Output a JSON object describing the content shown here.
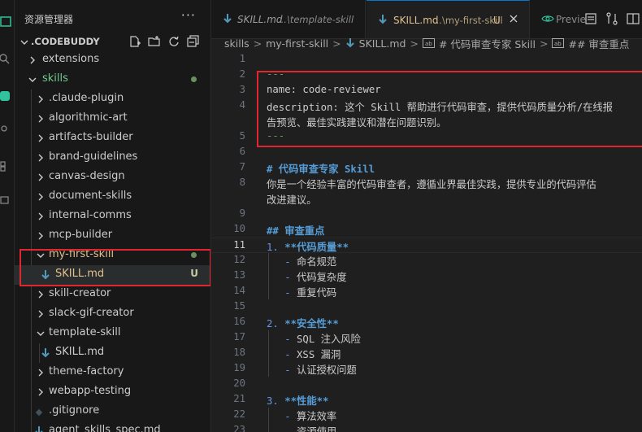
{
  "sidebar": {
    "title": "资源管理器",
    "more": "···",
    "section": "CODEBUDDY",
    "tree": [
      {
        "label": "extensions",
        "type": "folder",
        "open": false
      },
      {
        "label": "skills",
        "type": "folder",
        "open": true,
        "modified": true
      },
      {
        "label": ".claude-plugin",
        "type": "folder",
        "open": false
      },
      {
        "label": "algorithmic-art",
        "type": "folder",
        "open": false
      },
      {
        "label": "artifacts-builder",
        "type": "folder",
        "open": false
      },
      {
        "label": "brand-guidelines",
        "type": "folder",
        "open": false
      },
      {
        "label": "canvas-design",
        "type": "folder",
        "open": false
      },
      {
        "label": "document-skills",
        "type": "folder",
        "open": false
      },
      {
        "label": "internal-comms",
        "type": "folder",
        "open": false
      },
      {
        "label": "mcp-builder",
        "type": "folder",
        "open": false
      },
      {
        "label": "my-first-skill",
        "type": "folder",
        "open": true,
        "modified": true
      },
      {
        "label": "SKILL.md",
        "type": "file",
        "status": "U"
      },
      {
        "label": "skill-creator",
        "type": "folder",
        "open": false
      },
      {
        "label": "slack-gif-creator",
        "type": "folder",
        "open": false
      },
      {
        "label": "template-skill",
        "type": "folder",
        "open": true
      },
      {
        "label": "SKILL.md",
        "type": "file"
      },
      {
        "label": "theme-factory",
        "type": "folder",
        "open": false
      },
      {
        "label": "webapp-testing",
        "type": "folder",
        "open": false
      },
      {
        "label": ".gitignore",
        "type": "file"
      },
      {
        "label": "agent_skills_spec.md",
        "type": "file"
      }
    ]
  },
  "tabs": [
    {
      "name": "SKILL.md",
      "path": "...\\template-skill",
      "preview": true
    },
    {
      "name": "SKILL.md",
      "path": "...\\my-first-skill",
      "status": "U",
      "active": true
    },
    {
      "name": "Previe"
    }
  ],
  "breadcrumb": [
    "skills",
    "my-first-skill",
    "SKILL.md",
    "# 代码审查专家 Skill",
    "## 审查重点"
  ],
  "editor": {
    "current_line": 11,
    "lines": [
      {
        "n": "1",
        "parts": []
      },
      {
        "n": "2",
        "parts": [
          {
            "t": "---",
            "c": "c-fence"
          }
        ]
      },
      {
        "n": "3",
        "parts": [
          {
            "t": "name: code-reviewer",
            "c": "c-text"
          }
        ]
      },
      {
        "n": "4",
        "parts": [
          {
            "t": "description: 这个 Skill 帮助进行代码审查，提供代码质量分析/在线报",
            "c": "c-text"
          }
        ]
      },
      {
        "n": "",
        "parts": [
          {
            "t": "告预览、最佳实践建议和潜在问题识别。",
            "c": "c-text"
          }
        ]
      },
      {
        "n": "5",
        "parts": [
          {
            "t": "---",
            "c": "c-fence"
          }
        ]
      },
      {
        "n": "6",
        "parts": []
      },
      {
        "n": "7",
        "parts": [
          {
            "t": "# 代码审查专家 Skill",
            "c": "c-head"
          }
        ]
      },
      {
        "n": "8",
        "parts": [
          {
            "t": "你是一个经验丰富的代码审查者，遵循业界最佳实践，提供专业的代码评估",
            "c": "c-text"
          }
        ]
      },
      {
        "n": "",
        "parts": [
          {
            "t": "改进建议。",
            "c": "c-text"
          }
        ]
      },
      {
        "n": "9",
        "parts": []
      },
      {
        "n": "10",
        "parts": [
          {
            "t": "## 审查重点",
            "c": "c-head"
          }
        ]
      },
      {
        "n": "11",
        "parts": [
          {
            "t": "1. ",
            "c": "c-num"
          },
          {
            "t": "**代码质量**",
            "c": "c-bold"
          }
        ]
      },
      {
        "n": "12",
        "parts": [
          {
            "t": "   - ",
            "c": "c-bullet"
          },
          {
            "t": "命名规范",
            "c": "c-text"
          }
        ]
      },
      {
        "n": "13",
        "parts": [
          {
            "t": "   - ",
            "c": "c-bullet"
          },
          {
            "t": "代码复杂度",
            "c": "c-text"
          }
        ]
      },
      {
        "n": "14",
        "parts": [
          {
            "t": "   - ",
            "c": "c-bullet"
          },
          {
            "t": "重复代码",
            "c": "c-text"
          }
        ]
      },
      {
        "n": "15",
        "parts": []
      },
      {
        "n": "16",
        "parts": [
          {
            "t": "2. ",
            "c": "c-num"
          },
          {
            "t": "**安全性**",
            "c": "c-bold"
          }
        ]
      },
      {
        "n": "17",
        "parts": [
          {
            "t": "   - ",
            "c": "c-bullet"
          },
          {
            "t": "SQL 注入风险",
            "c": "c-text"
          }
        ]
      },
      {
        "n": "18",
        "parts": [
          {
            "t": "   - ",
            "c": "c-bullet"
          },
          {
            "t": "XSS 漏洞",
            "c": "c-text"
          }
        ]
      },
      {
        "n": "19",
        "parts": [
          {
            "t": "   - ",
            "c": "c-bullet"
          },
          {
            "t": "认证授权问题",
            "c": "c-text"
          }
        ]
      },
      {
        "n": "20",
        "parts": []
      },
      {
        "n": "21",
        "parts": [
          {
            "t": "3. ",
            "c": "c-num"
          },
          {
            "t": "**性能**",
            "c": "c-bold"
          }
        ]
      },
      {
        "n": "22",
        "parts": [
          {
            "t": "   - ",
            "c": "c-bullet"
          },
          {
            "t": "算法效率",
            "c": "c-text"
          }
        ]
      },
      {
        "n": "23",
        "parts": [
          {
            "t": "   - ",
            "c": "c-bullet"
          },
          {
            "t": "资源使用",
            "c": "c-text"
          }
        ]
      }
    ]
  },
  "colors": {
    "accent": "#0078d4",
    "highlight_box": "#e0262f",
    "untracked": "#e2c08d"
  }
}
